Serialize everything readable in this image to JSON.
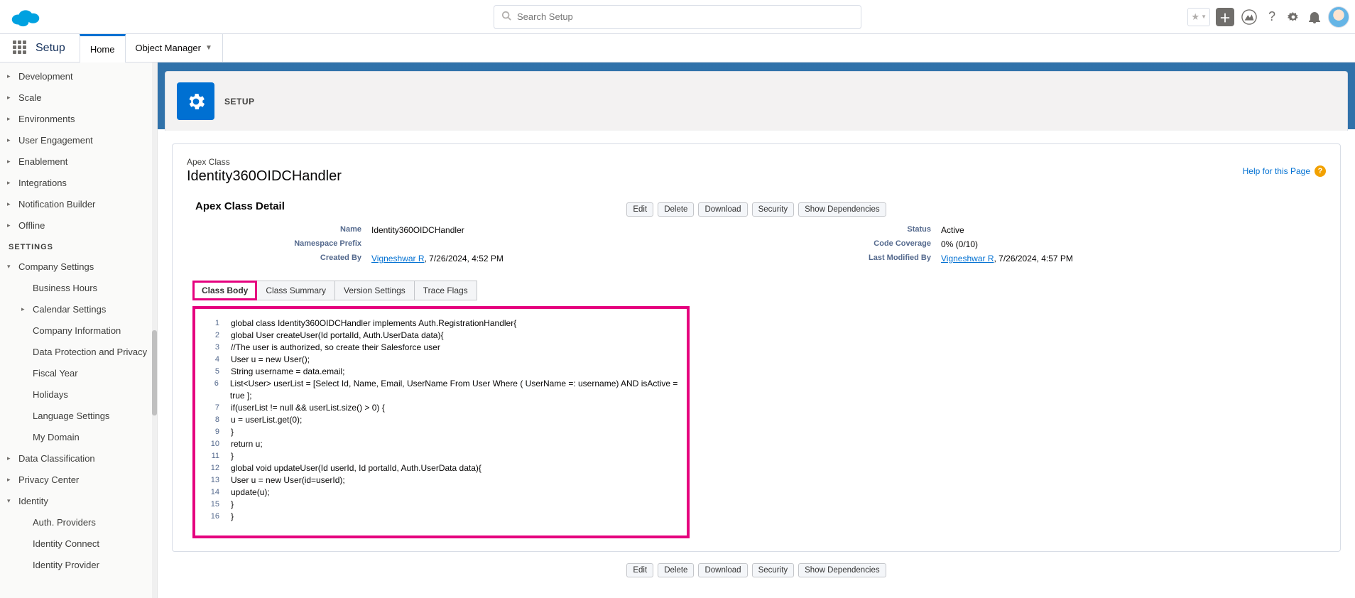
{
  "header": {
    "search_placeholder": "Search Setup"
  },
  "nav": {
    "app_title": "Setup",
    "tab_home": "Home",
    "tab_object_manager": "Object Manager"
  },
  "sidebar": {
    "items_top": [
      "Development",
      "Scale",
      "Environments",
      "User Engagement",
      "Enablement",
      "Integrations",
      "Notification Builder",
      "Offline"
    ],
    "settings_header": "SETTINGS",
    "company_settings": "Company Settings",
    "company_children": [
      "Business Hours",
      "Calendar Settings",
      "Company Information",
      "Data Protection and Privacy",
      "Fiscal Year",
      "Holidays",
      "Language Settings",
      "My Domain"
    ],
    "after_company": [
      "Data Classification",
      "Privacy Center"
    ],
    "identity": "Identity",
    "identity_children": [
      "Auth. Providers",
      "Identity Connect",
      "Identity Provider"
    ]
  },
  "banner": {
    "eyebrow": "SETUP"
  },
  "detail": {
    "sub": "Apex Class",
    "title": "Identity360OIDCHandler",
    "help": "Help for this Page",
    "section": "Apex Class Detail",
    "buttons": [
      "Edit",
      "Delete",
      "Download",
      "Security",
      "Show Dependencies"
    ],
    "labels": {
      "name": "Name",
      "namespace": "Namespace Prefix",
      "created_by": "Created By",
      "status": "Status",
      "coverage": "Code Coverage",
      "modified_by": "Last Modified By"
    },
    "values": {
      "name": "Identity360OIDCHandler",
      "namespace": "",
      "created_by_user": "Vigneshwar R",
      "created_by_date": ", 7/26/2024, 4:52 PM",
      "status": "Active",
      "coverage": "0% (0/10)",
      "modified_by_user": "Vigneshwar R",
      "modified_by_date": ", 7/26/2024, 4:57 PM"
    }
  },
  "tabs": [
    "Class Body",
    "Class Summary",
    "Version Settings",
    "Trace Flags"
  ],
  "code": [
    "global class Identity360OIDCHandler implements Auth.RegistrationHandler{",
    "global User createUser(Id portalId, Auth.UserData data){",
    "//The user is authorized, so create their Salesforce user",
    "User u = new User();",
    "String username = data.email;",
    "List<User> userList = [Select Id, Name, Email, UserName From User Where ( UserName =: username) AND isActive = true ];",
    "if(userList != null && userList.size() > 0) {",
    "u = userList.get(0);",
    "}",
    "return u;",
    "}",
    "global void updateUser(Id userId, Id portalId, Auth.UserData data){",
    "User u = new User(id=userId);",
    "update(u);",
    "}",
    "}"
  ]
}
